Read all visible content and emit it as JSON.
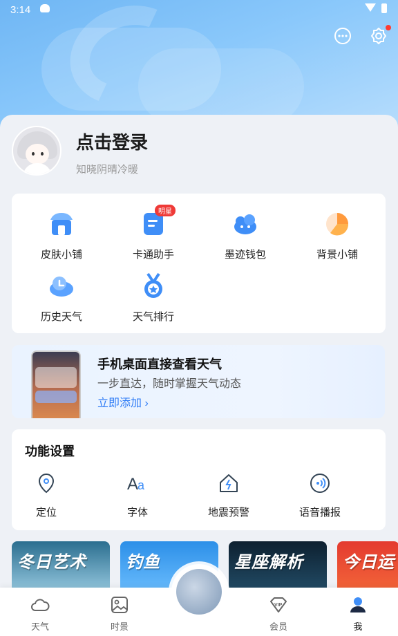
{
  "status_bar": {
    "time": "3:14"
  },
  "profile": {
    "title": "点击登录",
    "subtitle": "知晓阴晴冷暖"
  },
  "quick_grid": {
    "badge": "明星",
    "items": [
      {
        "label": "皮肤小铺",
        "icon": "shop-icon"
      },
      {
        "label": "卡通助手",
        "icon": "cartoon-assistant-icon"
      },
      {
        "label": "墨迹钱包",
        "icon": "wallet-icon"
      },
      {
        "label": "背景小铺",
        "icon": "background-shop-icon"
      },
      {
        "label": "历史天气",
        "icon": "history-weather-icon"
      },
      {
        "label": "天气排行",
        "icon": "ranking-medal-icon"
      }
    ]
  },
  "widget_banner": {
    "title": "手机桌面直接查看天气",
    "subtitle": "一步直达，随时掌握天气动态",
    "link": "立即添加 ›"
  },
  "function_settings": {
    "title": "功能设置",
    "items": [
      {
        "label": "定位",
        "icon": "location-pin-icon"
      },
      {
        "label": "字体",
        "icon": "font-icon"
      },
      {
        "label": "地震预警",
        "icon": "earthquake-house-icon"
      },
      {
        "label": "语音播报",
        "icon": "voice-broadcast-icon"
      }
    ]
  },
  "promos": [
    "冬日艺术",
    "钓鱼",
    "星座解析",
    "今日运"
  ],
  "tabbar": [
    {
      "label": "天气",
      "icon": "cloud-icon"
    },
    {
      "label": "时景",
      "icon": "picture-icon"
    },
    {
      "label": "会员",
      "icon": "vip-diamond-icon"
    },
    {
      "label": "我",
      "icon": "user-icon",
      "active": true
    }
  ],
  "colors": {
    "accent": "#2f7cf6",
    "badge": "#ef3a37",
    "hero": "#7fbff7"
  }
}
